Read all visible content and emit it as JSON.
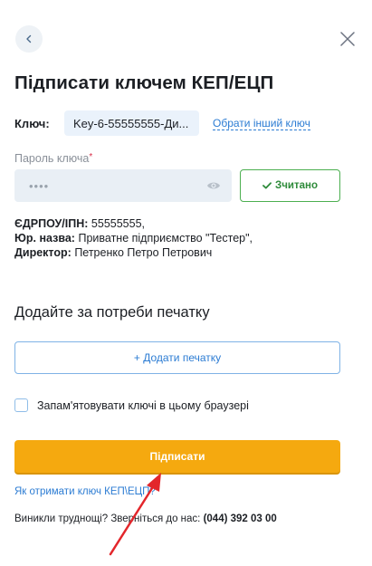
{
  "title": "Підписати ключем КЕП/ЕЦП",
  "key": {
    "label": "Ключ:",
    "value": "Key-6-55555555-Ди...",
    "change_link": "Обрати інший ключ"
  },
  "password": {
    "label": "Пароль ключа",
    "required_mark": "*",
    "masked_value": "••••",
    "read_button": "Зчитано"
  },
  "info": {
    "edrpou_label": "ЄДРПОУ/ІПН:",
    "edrpou_value": "55555555,",
    "org_label": "Юр. назва:",
    "org_value": "Приватне підприємство \"Тестер\",",
    "director_label": "Директор:",
    "director_value": "Петренко Петро Петрович"
  },
  "stamp": {
    "heading": "Додайте за потреби печатку",
    "add_button": "+ Додати печатку"
  },
  "remember": {
    "label": "Запам'ятовувати ключі в цьому браузері",
    "checked": false
  },
  "sign_button": "Підписати",
  "help_link": "Як отримати ключ КЕП\\ЕЦП?",
  "contact": {
    "text": "Виникли труднощі? Зверніться до нас:",
    "phone": "(044) 392 03 00"
  },
  "colors": {
    "accent_blue": "#2c7cd3",
    "sign_orange": "#f5a90f",
    "success_green": "#4caf50",
    "annotation_red": "#e3262b"
  }
}
